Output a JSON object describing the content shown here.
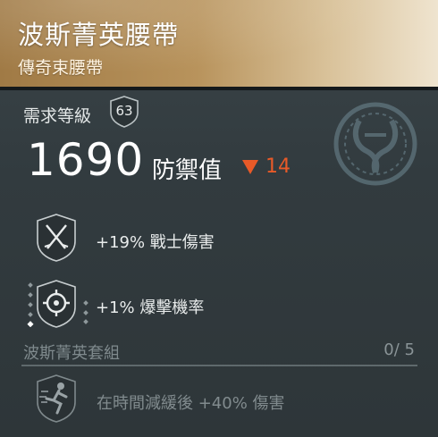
{
  "item": {
    "name": "波斯菁英腰帶",
    "type": "傳奇束腰帶"
  },
  "requirement": {
    "label": "需求等級",
    "level": "63"
  },
  "stat": {
    "value": "1690",
    "label": "防禦值",
    "diff": "14",
    "diff_direction": "down",
    "diff_color": "#e85a28"
  },
  "perks": [
    {
      "icon": "crossed-swords-icon",
      "text": "+19% 戰士傷害"
    },
    {
      "icon": "crosshair-icon",
      "text": "+1% 爆擊機率"
    }
  ],
  "set": {
    "title": "波斯菁英套組",
    "count": "0/ 5",
    "bonus_icon": "running-figure-icon",
    "bonus_text": "在時間減緩後 +40% 傷害"
  },
  "colors": {
    "header_gold": "#b8935c",
    "background": "#323b3f"
  }
}
